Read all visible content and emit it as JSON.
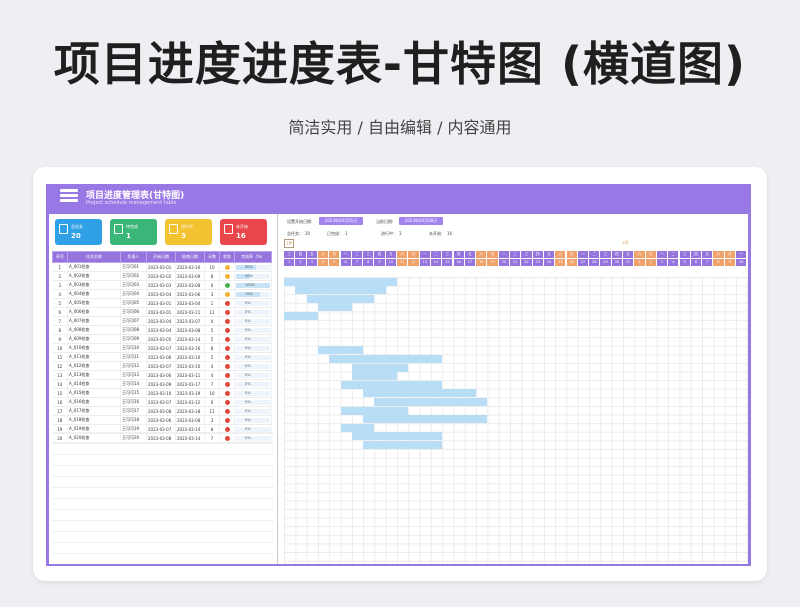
{
  "hero": {
    "title": "项目进度进度表-甘特图 (横道图)",
    "subtitle": "简洁实用 / 自由编辑 / 内容通用"
  },
  "sheet": {
    "title": "项目进度管理表(甘特图)",
    "subtitle": "Project schedule management table"
  },
  "colors": {
    "purple": "#9878e4",
    "header": "#9575dd",
    "weekend": "#f0a26b",
    "bar": "#b8ddf7"
  },
  "stats": [
    {
      "label": "总任务",
      "value": "20",
      "color": "#2fa0e6",
      "icon": "calendar-icon"
    },
    {
      "label": "待完成",
      "value": "1",
      "color": "#3ab679",
      "icon": "books-icon"
    },
    {
      "label": "进行中",
      "value": "3",
      "color": "#f2c231",
      "icon": "folder-icon"
    },
    {
      "label": "未开始",
      "value": "16",
      "color": "#e9464c",
      "icon": "layers-icon"
    }
  ],
  "table": {
    "headers": [
      "序号",
      "任务名称",
      "负责人",
      "开始日期",
      "结束日期",
      "天数",
      "状态",
      "完成率（%）"
    ],
    "rows": [
      {
        "no": "1",
        "name": "A_001检查",
        "owner": "王可可01",
        "start": "2023-03-01",
        "end": "2023-03-10",
        "days": "10",
        "status": "y",
        "progress": 60,
        "progress_text": "60%"
      },
      {
        "no": "2",
        "name": "A_002检查",
        "owner": "王可可02",
        "start": "2023-03-02",
        "end": "2023-03-09",
        "days": "8",
        "status": "y",
        "progress": 40,
        "progress_text": "40%"
      },
      {
        "no": "3",
        "name": "A_003检查",
        "owner": "王可可03",
        "start": "2023-03-03",
        "end": "2023-03-08",
        "days": "6",
        "status": "g",
        "progress": 100,
        "progress_text": "100%"
      },
      {
        "no": "4",
        "name": "A_004检查",
        "owner": "王可可04",
        "start": "2023-03-04",
        "end": "2023-03-06",
        "days": "3",
        "status": "y",
        "progress": 70,
        "progress_text": "70%"
      },
      {
        "no": "5",
        "name": "A_005检查",
        "owner": "王可可05",
        "start": "2023-03-01",
        "end": "2023-03-04",
        "days": "1",
        "status": "r",
        "progress": 0,
        "progress_text": "0%"
      },
      {
        "no": "6",
        "name": "A_006检查",
        "owner": "王可可06",
        "start": "2023-03-01",
        "end": "2023-03-11",
        "days": "11",
        "status": "r",
        "progress": 0,
        "progress_text": "0%"
      },
      {
        "no": "7",
        "name": "A_007检查",
        "owner": "王可可07",
        "start": "2023-03-04",
        "end": "2023-03-07",
        "days": "4",
        "status": "r",
        "progress": 0,
        "progress_text": "0%"
      },
      {
        "no": "8",
        "name": "A_008检查",
        "owner": "王可可08",
        "start": "2023-03-04",
        "end": "2023-03-08",
        "days": "5",
        "status": "r",
        "progress": 0,
        "progress_text": "0%"
      },
      {
        "no": "9",
        "name": "A_009检查",
        "owner": "王可可09",
        "start": "2023-03-05",
        "end": "2023-03-14",
        "days": "5",
        "status": "r",
        "progress": 0,
        "progress_text": "0%"
      },
      {
        "no": "10",
        "name": "A_010检查",
        "owner": "王可可10",
        "start": "2023-03-07",
        "end": "2023-03-16",
        "days": "8",
        "status": "r",
        "progress": 0,
        "progress_text": "0%"
      },
      {
        "no": "11",
        "name": "A_011检查",
        "owner": "王可可11",
        "start": "2023-03-06",
        "end": "2023-03-10",
        "days": "5",
        "status": "r",
        "progress": 0,
        "progress_text": "0%"
      },
      {
        "no": "12",
        "name": "A_012检查",
        "owner": "王可可12",
        "start": "2023-03-07",
        "end": "2023-03-10",
        "days": "4",
        "status": "r",
        "progress": 0,
        "progress_text": "0%"
      },
      {
        "no": "13",
        "name": "A_013检查",
        "owner": "王可可13",
        "start": "2023-03-06",
        "end": "2023-03-11",
        "days": "4",
        "status": "r",
        "progress": 0,
        "progress_text": "0%"
      },
      {
        "no": "14",
        "name": "A_014检查",
        "owner": "王可可14",
        "start": "2023-03-09",
        "end": "2023-03-17",
        "days": "7",
        "status": "r",
        "progress": 0,
        "progress_text": "0%"
      },
      {
        "no": "15",
        "name": "A_015检查",
        "owner": "王可可15",
        "start": "2023-03-10",
        "end": "2023-03-19",
        "days": "10",
        "status": "r",
        "progress": 0,
        "progress_text": "0%"
      },
      {
        "no": "16",
        "name": "A_016检查",
        "owner": "王可可16",
        "start": "2023-03-07",
        "end": "2023-03-12",
        "days": "6",
        "status": "r",
        "progress": 0,
        "progress_text": "0%"
      },
      {
        "no": "17",
        "name": "A_017检查",
        "owner": "王可可17",
        "start": "2023-03-08",
        "end": "2023-03-18",
        "days": "11",
        "status": "r",
        "progress": 0,
        "progress_text": "0%"
      },
      {
        "no": "18",
        "name": "A_018检查",
        "owner": "王可可18",
        "start": "2023-03-06",
        "end": "2023-03-08",
        "days": "3",
        "status": "r",
        "progress": 0,
        "progress_text": "0%"
      },
      {
        "no": "19",
        "name": "A_019检查",
        "owner": "王可可19",
        "start": "2023-03-07",
        "end": "2023-03-14",
        "days": "8",
        "status": "r",
        "progress": 0,
        "progress_text": "0%"
      },
      {
        "no": "20",
        "name": "A_020检查",
        "owner": "王可可20",
        "start": "2023-03-08",
        "end": "2023-03-14",
        "days": "7",
        "status": "r",
        "progress": 0,
        "progress_text": "0%"
      }
    ]
  },
  "gantt": {
    "start_label": "设置开始日期:",
    "start_date": "2023年03月01日",
    "today_label": "当前日期:",
    "today_date": "2023年03月08日",
    "summary": [
      {
        "label": "总任务：",
        "value": "20"
      },
      {
        "label": "已完成：",
        "value": "1"
      },
      {
        "label": "进行中：",
        "value": "3"
      },
      {
        "label": "未开始：",
        "value": "16"
      }
    ],
    "scroll_label": "工作",
    "week_marker": "+8",
    "weekdays": [
      "星期三",
      "星期四",
      "星期五",
      "星期六",
      "星期日",
      "星期一",
      "星期二",
      "星期三",
      "星期四",
      "星期五",
      "星期六",
      "星期日",
      "星期一",
      "星期二",
      "星期三",
      "星期四",
      "星期五",
      "星期六",
      "星期日",
      "星期一",
      "星期二",
      "星期三",
      "星期四",
      "星期五",
      "星期六",
      "星期日",
      "星期一",
      "星期二",
      "星期三",
      "星期四",
      "星期五",
      "星期六",
      "星期日",
      "星期一",
      "星期二",
      "星期三",
      "星期四",
      "星期五",
      "星期六",
      "星期日",
      "星期一"
    ],
    "days": [
      "1",
      "2",
      "3",
      "4",
      "5",
      "6",
      "7",
      "8",
      "9",
      "10",
      "11",
      "12",
      "13",
      "14",
      "15",
      "16",
      "17",
      "18",
      "19",
      "20",
      "21",
      "22",
      "23",
      "24",
      "25",
      "26",
      "27",
      "28",
      "29",
      "30",
      "31",
      "1",
      "2",
      "3",
      "4",
      "5",
      "6",
      "7",
      "8",
      "9",
      "10"
    ],
    "weekend_days": [
      3,
      4,
      10,
      11,
      17,
      18,
      24,
      25,
      31,
      32,
      38,
      39
    ],
    "bars": [
      {
        "start": 1,
        "end": 10
      },
      {
        "start": 2,
        "end": 9
      },
      {
        "start": 3,
        "end": 8
      },
      {
        "start": 4,
        "end": 6
      },
      {
        "start": 1,
        "end": 3
      },
      {
        "start": 0,
        "end": 0
      },
      {
        "start": 0,
        "end": 0
      },
      {
        "start": 0,
        "end": 0
      },
      {
        "start": 4,
        "end": 7
      },
      {
        "start": 5,
        "end": 14
      },
      {
        "start": 7,
        "end": 11
      },
      {
        "start": 7,
        "end": 10
      },
      {
        "start": 6,
        "end": 14
      },
      {
        "start": 8,
        "end": 17
      },
      {
        "start": 9,
        "end": 18
      },
      {
        "start": 6,
        "end": 11
      },
      {
        "start": 8,
        "end": 18
      },
      {
        "start": 6,
        "end": 8
      },
      {
        "start": 7,
        "end": 14
      },
      {
        "start": 8,
        "end": 14
      }
    ]
  }
}
